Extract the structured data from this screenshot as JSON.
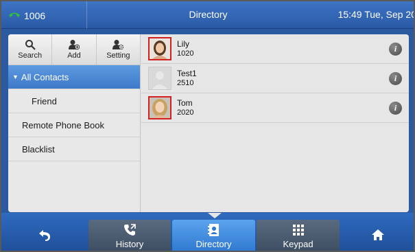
{
  "topbar": {
    "line_label": "1006",
    "title": "Directory",
    "clock": "15:49 Tue, Sep 20"
  },
  "toolbar": {
    "search_label": "Search",
    "add_label": "Add",
    "setting_label": "Setting"
  },
  "sidebar": {
    "items": [
      {
        "label": "All Contacts",
        "active": true
      },
      {
        "label": "Friend"
      },
      {
        "label": "Remote Phone Book"
      },
      {
        "label": "Blacklist"
      }
    ]
  },
  "contacts": [
    {
      "name": "Lily",
      "number": "1020",
      "avatar": "female-photo"
    },
    {
      "name": "Test1",
      "number": "2510",
      "avatar": "default-silhouette"
    },
    {
      "name": "Tom",
      "number": "2020",
      "avatar": "female-photo-blonde"
    }
  ],
  "info_glyph": "i",
  "bottombar": {
    "history_label": "History",
    "directory_label": "Directory",
    "keypad_label": "Keypad"
  },
  "colors": {
    "accent": "#2f6bc0",
    "active_tab": "#3c79c8",
    "phone_icon": "#2fbf3a",
    "avatar_highlight": "#d21f1f"
  }
}
